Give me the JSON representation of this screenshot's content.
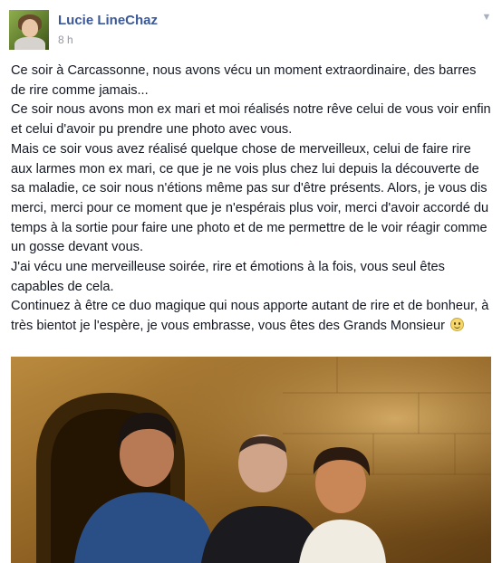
{
  "post": {
    "author_name": "Lucie LineChaz",
    "timestamp": "8 h",
    "menu_icon": "chevron-down-icon",
    "paragraphs": [
      "Ce soir à Carcassonne, nous avons vécu un moment extraordinaire, des barres de rire comme jamais...",
      "Ce soir nous avons mon ex mari et moi réalisés notre rêve celui de vous voir enfin et celui d'avoir pu prendre une photo avec vous.",
      "Mais ce soir vous avez réalisé quelque chose de merveilleux, celui de faire rire aux larmes mon ex mari, ce que je ne vois plus chez lui depuis la découverte de sa maladie, ce soir nous n'étions même pas sur d'être présents. Alors, je vous dis merci, merci pour ce moment que je n'espérais plus voir, merci d'avoir accordé du temps à la sortie pour faire une photo et de me permettre de le voir réagir comme un gosse devant vous.",
      "J'ai vécu une merveilleuse soirée, rire et émotions à la fois, vous seul êtes capables de cela.",
      "Continuez à être ce duo magique qui nous apporte autant de rire et de bonheur, à très bientot je l'espère, je vous embrasse, vous êtes des Grands Monsieur"
    ],
    "emoticon": "smiley-icon"
  },
  "colors": {
    "author_link": "#3b5998",
    "timestamp": "#9197a3",
    "body_text": "#141823"
  }
}
